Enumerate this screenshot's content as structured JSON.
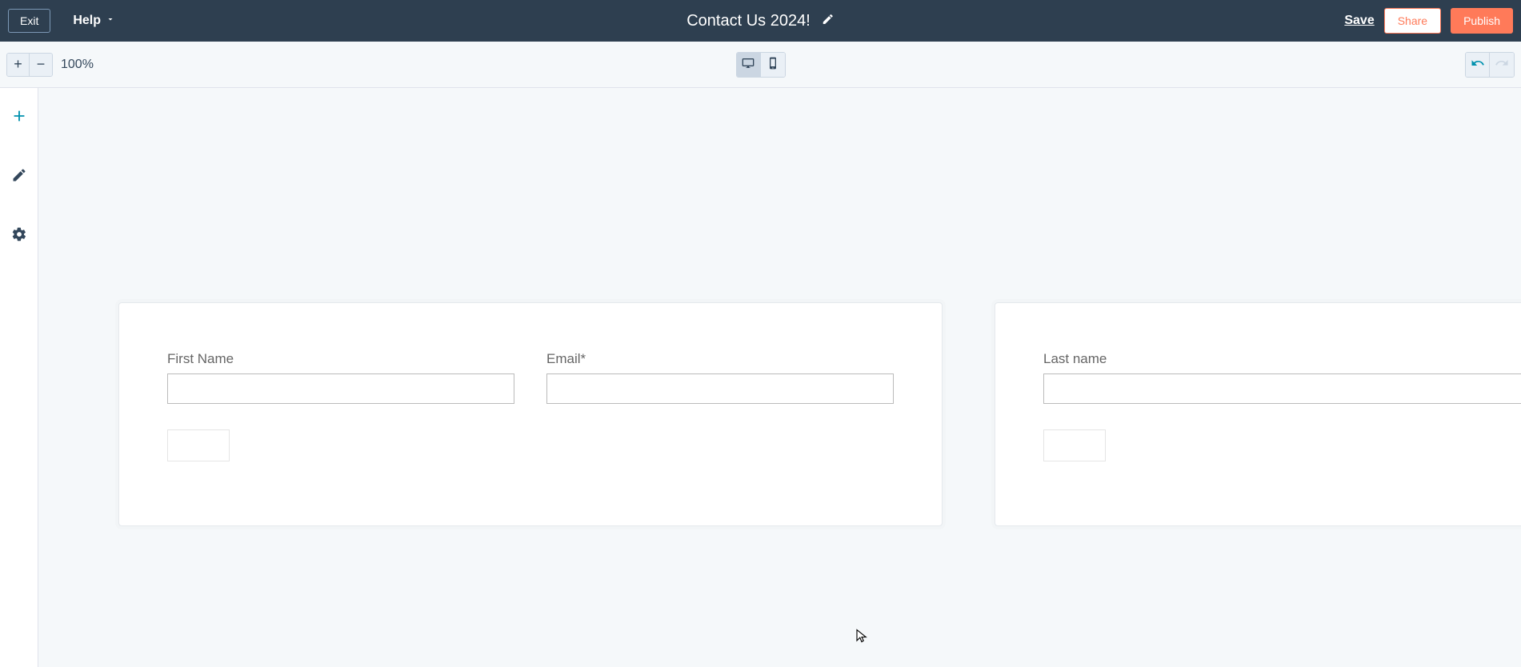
{
  "header": {
    "exit_label": "Exit",
    "help_label": "Help",
    "page_title": "Contact Us 2024!",
    "save_label": "Save",
    "share_label": "Share",
    "publish_label": "Publish"
  },
  "toolbar": {
    "zoom": "100%"
  },
  "forms": [
    {
      "fields": [
        {
          "label": "First Name",
          "value": ""
        },
        {
          "label": "Email*",
          "value": ""
        }
      ]
    },
    {
      "fields": [
        {
          "label": "Last name",
          "value": ""
        }
      ]
    }
  ]
}
